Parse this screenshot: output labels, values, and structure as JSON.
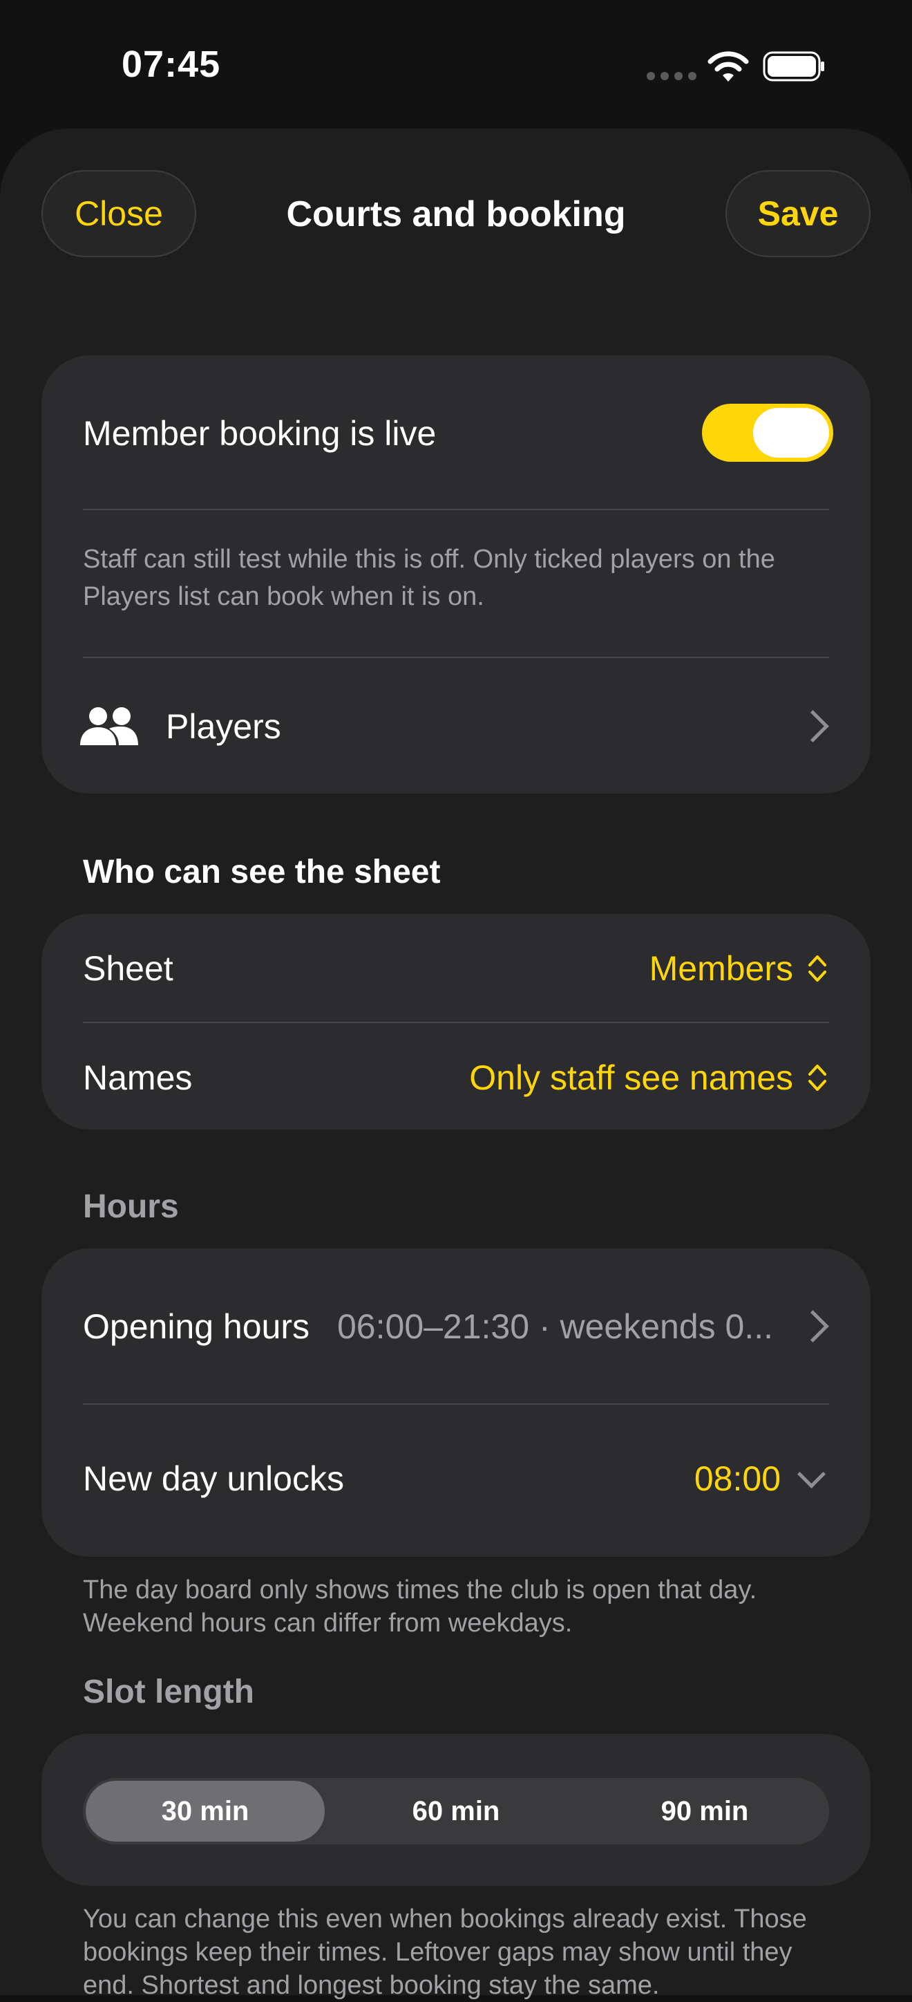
{
  "status_bar": {
    "time": "07:45"
  },
  "header": {
    "title": "Courts and booking",
    "close_label": "Close",
    "save_label": "Save"
  },
  "booking_card": {
    "live_label": "Member booking is live",
    "live_on": true,
    "description": "Staff can still test while this is off. Only ticked players on the Players list can book when it is on.",
    "players_label": "Players"
  },
  "visibility": {
    "header": "Who can see the sheet",
    "sheet_label": "Sheet",
    "sheet_value": "Members",
    "names_label": "Names",
    "names_value": "Only staff see names"
  },
  "hours": {
    "header": "Hours",
    "opening_label": "Opening hours",
    "opening_value": "06:00–21:30 · weekends 0...",
    "unlock_label": "New day unlocks",
    "unlock_value": "08:00",
    "footnote": "The day board only shows times the club is open that day. Weekend hours can differ from weekdays."
  },
  "slot": {
    "header": "Slot length",
    "options": [
      "30 min",
      "60 min",
      "90 min"
    ],
    "selected": "30 min",
    "footnote": "You can change this even when bookings already exist. Those bookings keep their times. Leftover gaps may show until they end. Shortest and longest booking stay the same."
  },
  "colors": {
    "accent": "#ffd60a",
    "background": "#121212",
    "card": "#2c2c2e",
    "muted": "#a1a1a6"
  },
  "icons": {
    "players": "people-icon",
    "wifi": "wifi-icon",
    "battery": "battery-icon",
    "cellular": "cellular-signal-icon"
  }
}
